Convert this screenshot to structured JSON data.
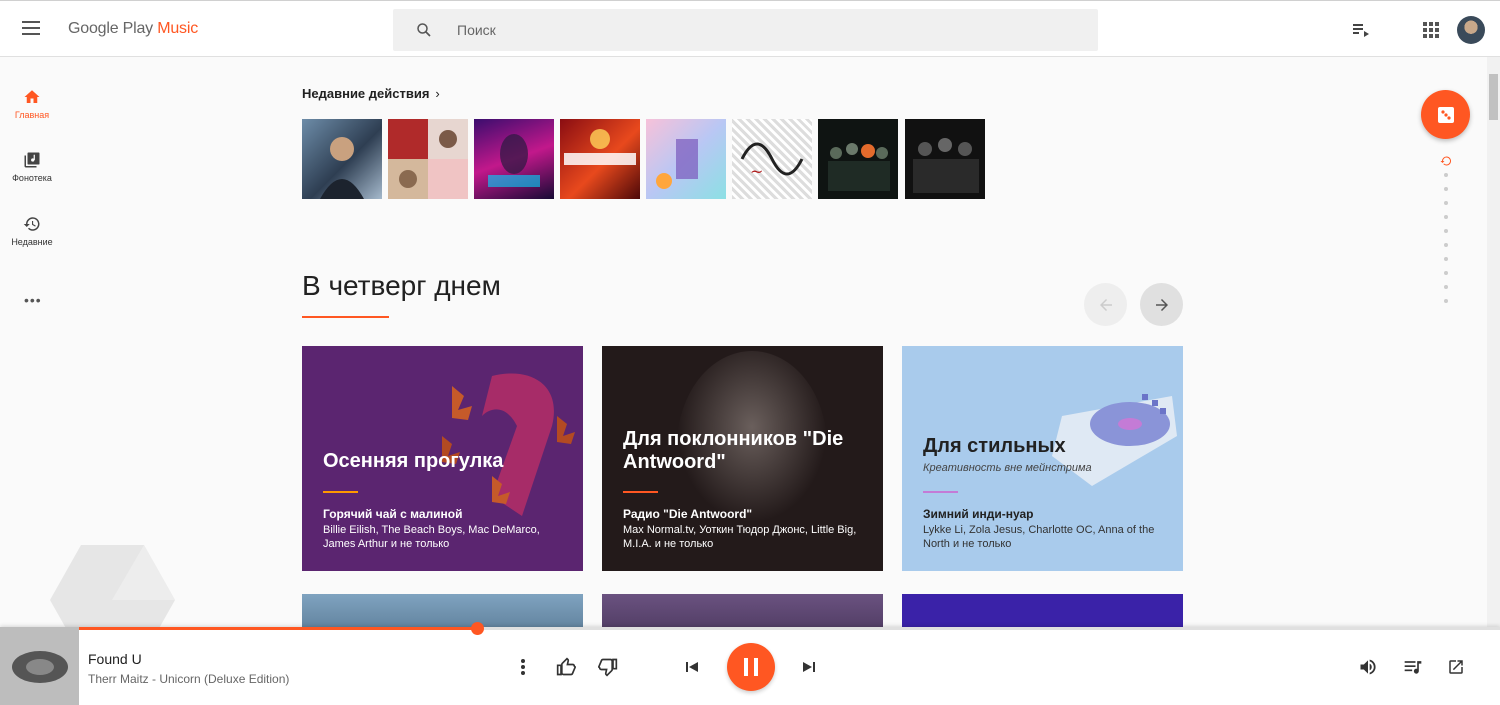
{
  "header": {
    "logo_main": "Google Play ",
    "logo_accent": "Music",
    "search_placeholder": "Поиск"
  },
  "nav": {
    "items": [
      {
        "label": "Главная",
        "icon": "home-icon",
        "active": true
      },
      {
        "label": "Фонотека",
        "icon": "library-icon",
        "active": false
      },
      {
        "label": "Недавние",
        "icon": "history-icon",
        "active": false
      }
    ],
    "more": "•••"
  },
  "recent": {
    "title": "Недавние действия",
    "chevron": "›"
  },
  "section": {
    "title": "В четверг днем"
  },
  "cards": [
    {
      "title": "Осенняя прогулка",
      "subtitle": "",
      "station": "Горячий чай с малиной",
      "artists": "Billie Eilish, The Beach Boys, Mac DeMarco, James Arthur и не только",
      "bg": "#5b2570",
      "accent": "#ff9800"
    },
    {
      "title": "Для поклонников \"Die Antwoord\"",
      "subtitle": "",
      "station": "Радио \"Die Antwoord\"",
      "artists": "Max Normal.tv, Уоткин Тюдор Джонс, Little Big, M.I.A. и не только",
      "bg": "#231a1a",
      "accent": "#ff5722"
    },
    {
      "title": "Для стильных",
      "subtitle": "Креативность вне мейнстрима",
      "station": "Зимний инди-нуар",
      "artists": "Lykke Li, Zola Jesus, Charlotte OC, Anna of the North и не только",
      "bg": "#a9cbec",
      "accent": "#c47bd6"
    }
  ],
  "player": {
    "track_title": "Found U",
    "track_sub": "Therr Maitz - Unicorn (Deluxe Edition)",
    "progress": 0.28
  },
  "colors": {
    "accent": "#ff5722"
  }
}
